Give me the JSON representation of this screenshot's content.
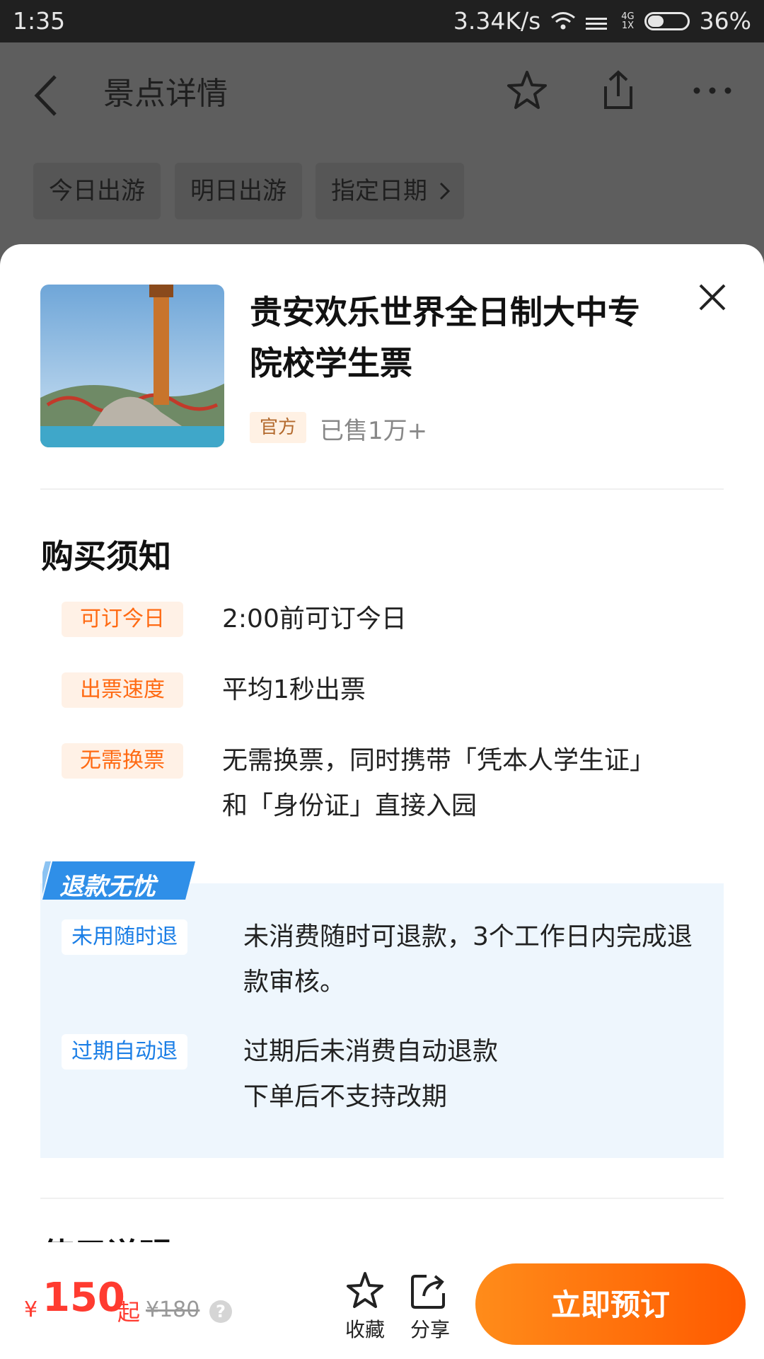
{
  "status_bar": {
    "time": "1:35",
    "net_speed": "3.34K/s",
    "net_type": "4G",
    "net_type2": "1X",
    "battery": "36%"
  },
  "header": {
    "title": "景点详情",
    "date_options": [
      "今日出游",
      "明日出游",
      "指定日期"
    ]
  },
  "product": {
    "title": "贵安欢乐世界全日制大中专院校学生票",
    "badge": "官方",
    "sold": "已售1万+"
  },
  "purchase_notice": {
    "heading": "购买须知",
    "rules": [
      {
        "tag": "可订今日",
        "text": "2:00前可订今日"
      },
      {
        "tag": "出票速度",
        "text": "平均1秒出票"
      },
      {
        "tag": "无需换票",
        "text": "无需换票，同时携带「凭本人学生证」和「身份证」直接入园"
      }
    ],
    "refund": {
      "banner": "退款无忧",
      "items": [
        {
          "tag": "未用随时退",
          "text": "未消费随时可退款，3个工作日内完成退款审核。"
        },
        {
          "tag": "过期自动退",
          "line1": "过期后未消费自动退款",
          "line2": "下单后不支持改期"
        }
      ]
    },
    "next_heading": "使用说明"
  },
  "bottom_bar": {
    "currency": "¥",
    "price": "150",
    "price_suffix": "起",
    "original_price": "¥180",
    "help": "?",
    "favorite_label": "收藏",
    "share_label": "分享",
    "book_label": "立即预订"
  },
  "colors": {
    "accent": "#ff6a13",
    "price": "#ff3b30",
    "refund_blue": "#1a7ee6",
    "overlay": "#5e5e5e"
  }
}
